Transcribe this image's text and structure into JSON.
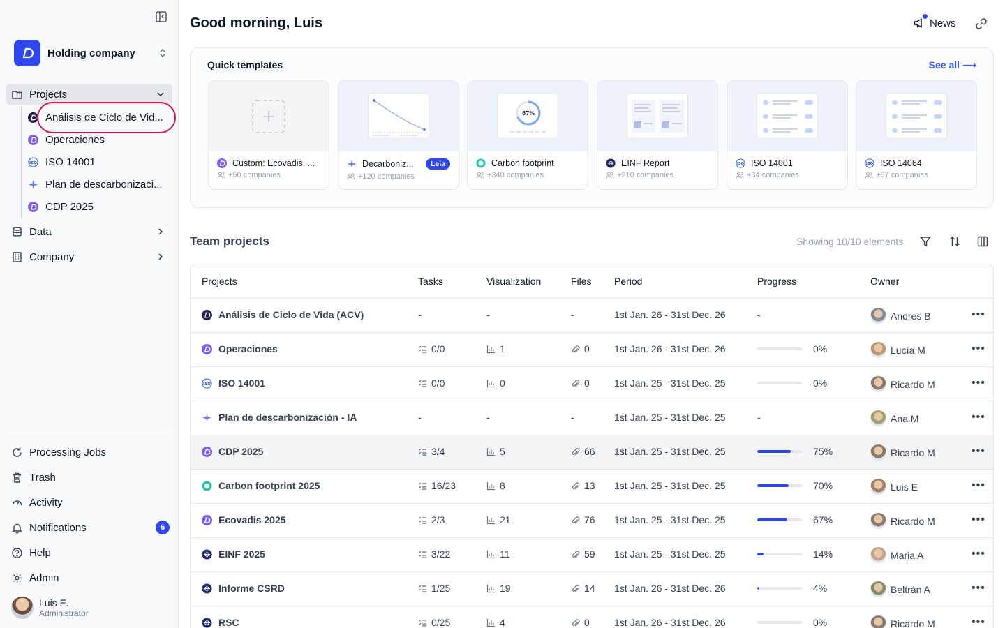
{
  "sidebar": {
    "org_name": "Holding company",
    "projects_label": "Projects",
    "projects_sub": [
      "Análisis de Ciclo de Vid...",
      "Operaciones",
      "ISO 14001",
      "Plan de descarbonizaci...",
      "CDP 2025"
    ],
    "data_label": "Data",
    "company_label": "Company",
    "bottom": {
      "processing": "Processing Jobs",
      "trash": "Trash",
      "activity": "Activity",
      "notifications": "Notifications",
      "notifications_count": "6",
      "help": "Help",
      "admin": "Admin"
    },
    "user": {
      "name": "Luis E.",
      "role": "Administrator"
    }
  },
  "header": {
    "greeting": "Good morning, Luis",
    "news": "News"
  },
  "templates": {
    "title": "Quick templates",
    "see_all": "See all ⟶",
    "cards": [
      {
        "title": "Custom: Ecovadis, ...",
        "sub": "+50 companies"
      },
      {
        "title": "Decarboniz...",
        "sub": "+120 companies",
        "badge": "Leia"
      },
      {
        "title": "Carbon footprint",
        "sub": "+340 companies",
        "ring": "67%"
      },
      {
        "title": "EINF Report",
        "sub": "+210 companies"
      },
      {
        "title": "ISO 14001",
        "sub": "+34 companies"
      },
      {
        "title": "ISO 14064",
        "sub": "+67 companies"
      }
    ]
  },
  "team": {
    "title": "Team projects",
    "showing": "Showing 10/10 elements",
    "columns": [
      "Projects",
      "Tasks",
      "Visualization",
      "Files",
      "Period",
      "Progress",
      "Owner"
    ],
    "rows": [
      {
        "name": "Análisis de Ciclo de Vida (ACV)",
        "tasks": "-",
        "viz": "-",
        "files": "-",
        "period": "1st Jan. 26 - 31st Dec. 26",
        "progress": "-",
        "owner": "Andres B"
      },
      {
        "name": "Operaciones",
        "tasks": "0/0",
        "viz": "1",
        "files": "0",
        "period": "1st Jan. 26 - 31st Dec. 26",
        "progress": "0%",
        "owner": "Lucía M"
      },
      {
        "name": "ISO 14001",
        "tasks": "0/0",
        "viz": "0",
        "files": "0",
        "period": "1st Jan. 25 - 31st Dec. 25",
        "progress": "0%",
        "owner": "Ricardo M"
      },
      {
        "name": "Plan de descarbonización - IA",
        "tasks": "-",
        "viz": "-",
        "files": "-",
        "period": "1st Jan. 25 - 31st Dec. 25",
        "progress": "-",
        "owner": "Ana M"
      },
      {
        "name": "CDP 2025",
        "tasks": "3/4",
        "viz": "5",
        "files": "66",
        "period": "1st Jan. 25 - 31st Dec. 25",
        "progress": "75%",
        "owner": "Ricardo M"
      },
      {
        "name": "Carbon footprint 2025",
        "tasks": "16/23",
        "viz": "8",
        "files": "13",
        "period": "1st Jan. 25 - 31st Dec. 25",
        "progress": "70%",
        "owner": "Luis E"
      },
      {
        "name": "Ecovadis 2025",
        "tasks": "2/3",
        "viz": "21",
        "files": "76",
        "period": "1st Jan. 25 - 31st Dec. 25",
        "progress": "67%",
        "owner": "Ricardo M"
      },
      {
        "name": "EINF 2025",
        "tasks": "3/22",
        "viz": "11",
        "files": "59",
        "period": "1st Jan. 25 - 31st Dec. 25",
        "progress": "14%",
        "owner": "Maria A"
      },
      {
        "name": "Informe CSRD",
        "tasks": "1/25",
        "viz": "19",
        "files": "14",
        "period": "1st Jan. 26 - 31st Dec. 26",
        "progress": "4%",
        "owner": "Beltrán A"
      },
      {
        "name": "RSC",
        "tasks": "0/25",
        "viz": "4",
        "files": "0",
        "period": "1st Jan. 26 - 31st Dec. 26",
        "progress": "0%",
        "owner": "Ricardo M"
      }
    ]
  },
  "colors": {
    "accent": "#2f47f0",
    "highlight_ring": "#d6194a"
  }
}
